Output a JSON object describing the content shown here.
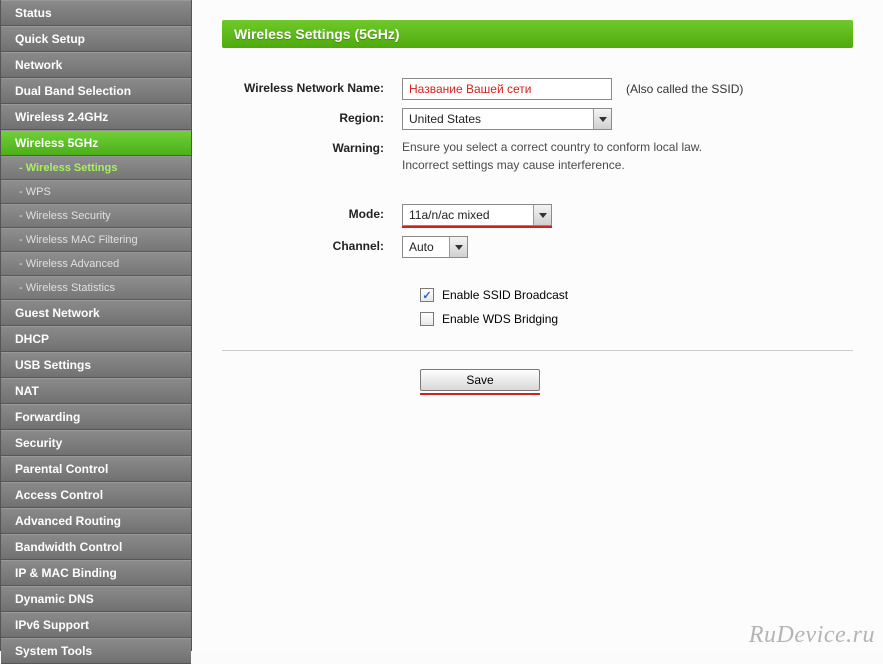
{
  "sidebar": {
    "items": [
      {
        "label": "Status",
        "type": "nav",
        "active": false
      },
      {
        "label": "Quick Setup",
        "type": "nav",
        "active": false
      },
      {
        "label": "Network",
        "type": "nav",
        "active": false
      },
      {
        "label": "Dual Band Selection",
        "type": "nav",
        "active": false
      },
      {
        "label": "Wireless 2.4GHz",
        "type": "nav",
        "active": false
      },
      {
        "label": "Wireless 5GHz",
        "type": "nav",
        "active": true
      },
      {
        "label": "- Wireless Settings",
        "type": "sub",
        "current": true
      },
      {
        "label": "- WPS",
        "type": "sub",
        "current": false
      },
      {
        "label": "- Wireless Security",
        "type": "sub",
        "current": false
      },
      {
        "label": "- Wireless MAC Filtering",
        "type": "sub",
        "current": false
      },
      {
        "label": "- Wireless Advanced",
        "type": "sub",
        "current": false
      },
      {
        "label": "- Wireless Statistics",
        "type": "sub",
        "current": false
      },
      {
        "label": "Guest Network",
        "type": "nav",
        "active": false
      },
      {
        "label": "DHCP",
        "type": "nav",
        "active": false
      },
      {
        "label": "USB Settings",
        "type": "nav",
        "active": false
      },
      {
        "label": "NAT",
        "type": "nav",
        "active": false
      },
      {
        "label": "Forwarding",
        "type": "nav",
        "active": false
      },
      {
        "label": "Security",
        "type": "nav",
        "active": false
      },
      {
        "label": "Parental Control",
        "type": "nav",
        "active": false
      },
      {
        "label": "Access Control",
        "type": "nav",
        "active": false
      },
      {
        "label": "Advanced Routing",
        "type": "nav",
        "active": false
      },
      {
        "label": "Bandwidth Control",
        "type": "nav",
        "active": false
      },
      {
        "label": "IP & MAC Binding",
        "type": "nav",
        "active": false
      },
      {
        "label": "Dynamic DNS",
        "type": "nav",
        "active": false
      },
      {
        "label": "IPv6 Support",
        "type": "nav",
        "active": false
      },
      {
        "label": "System Tools",
        "type": "nav",
        "active": false
      }
    ]
  },
  "page": {
    "title": "Wireless Settings (5GHz)",
    "labels": {
      "ssid": "Wireless Network Name:",
      "region": "Region:",
      "warning": "Warning:",
      "mode": "Mode:",
      "channel": "Channel:"
    },
    "ssid_value": "Название Вашей сети",
    "ssid_note": "(Also called the SSID)",
    "region_value": "United States",
    "warning_text": "Ensure you select a correct country to conform local law.\nIncorrect settings may cause interference.",
    "mode_value": "11a/n/ac mixed",
    "channel_value": "Auto",
    "checkboxes": {
      "ssid_broadcast": {
        "label": "Enable SSID Broadcast",
        "checked": true
      },
      "wds_bridging": {
        "label": "Enable WDS Bridging",
        "checked": false
      }
    },
    "save_label": "Save"
  },
  "watermark": "RuDevice.ru"
}
